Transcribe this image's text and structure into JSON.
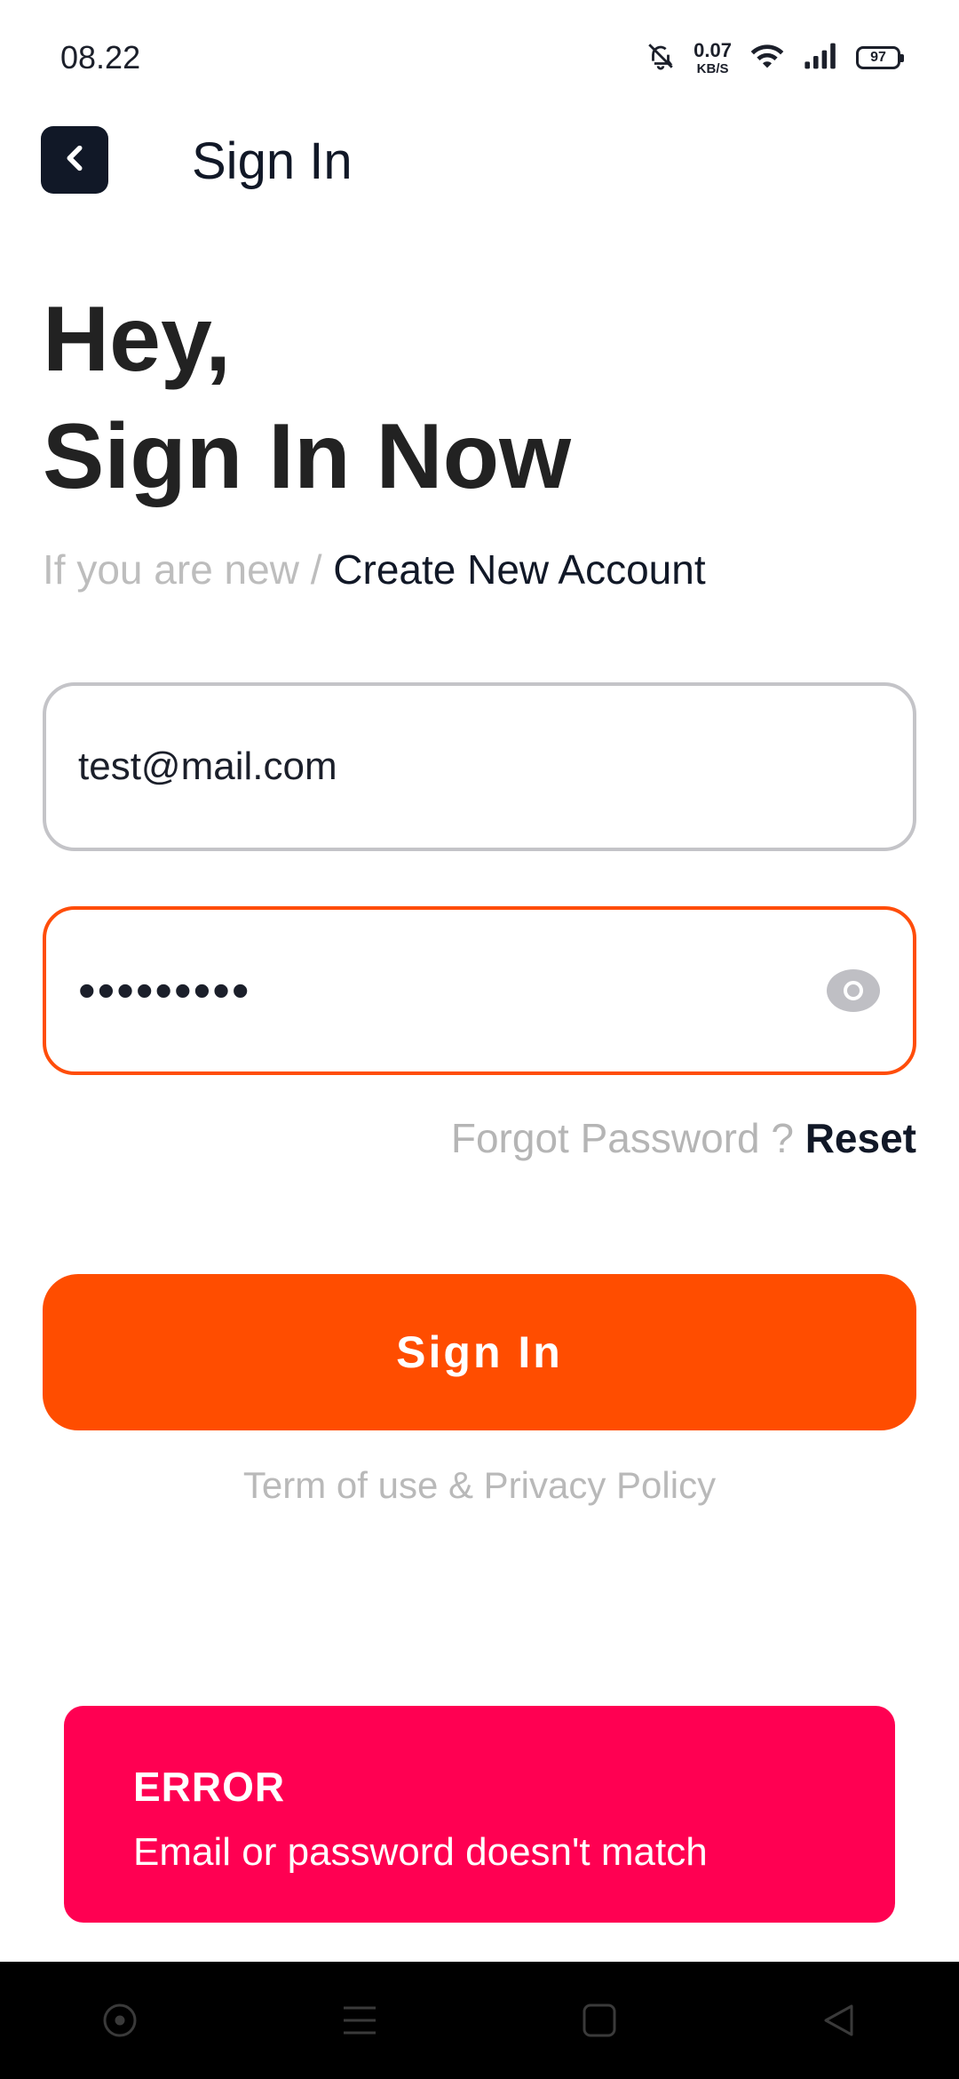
{
  "status_bar": {
    "time": "08.22",
    "net_speed_value": "0.07",
    "net_speed_unit": "KB/S",
    "battery": "97",
    "icons": [
      "mute-bell-icon",
      "wifi-icon",
      "signal-icon",
      "battery-icon"
    ]
  },
  "header": {
    "title": "Sign In",
    "back_icon": "chevron-left-icon"
  },
  "hero": {
    "line1": "Hey,",
    "line2": "Sign In Now"
  },
  "subline": {
    "prefix": "If you are new / ",
    "link": "Create New Account"
  },
  "form": {
    "email_value": "test@mail.com",
    "password_mask": "•••••••••",
    "password_visibility_icon": "eye-icon"
  },
  "forgot": {
    "prefix": "Forgot Password ? ",
    "link": "Reset"
  },
  "signin_button": "Sign In",
  "terms": "Term of use & Privacy Policy",
  "toast": {
    "title": "ERROR",
    "message": "Email or password doesn't match"
  },
  "colors": {
    "accent": "#ff4d00",
    "error": "#ff0052",
    "dark": "#111827"
  },
  "nav": [
    "circle-button-icon",
    "menu-icon",
    "home-square-icon",
    "back-triangle-icon"
  ]
}
